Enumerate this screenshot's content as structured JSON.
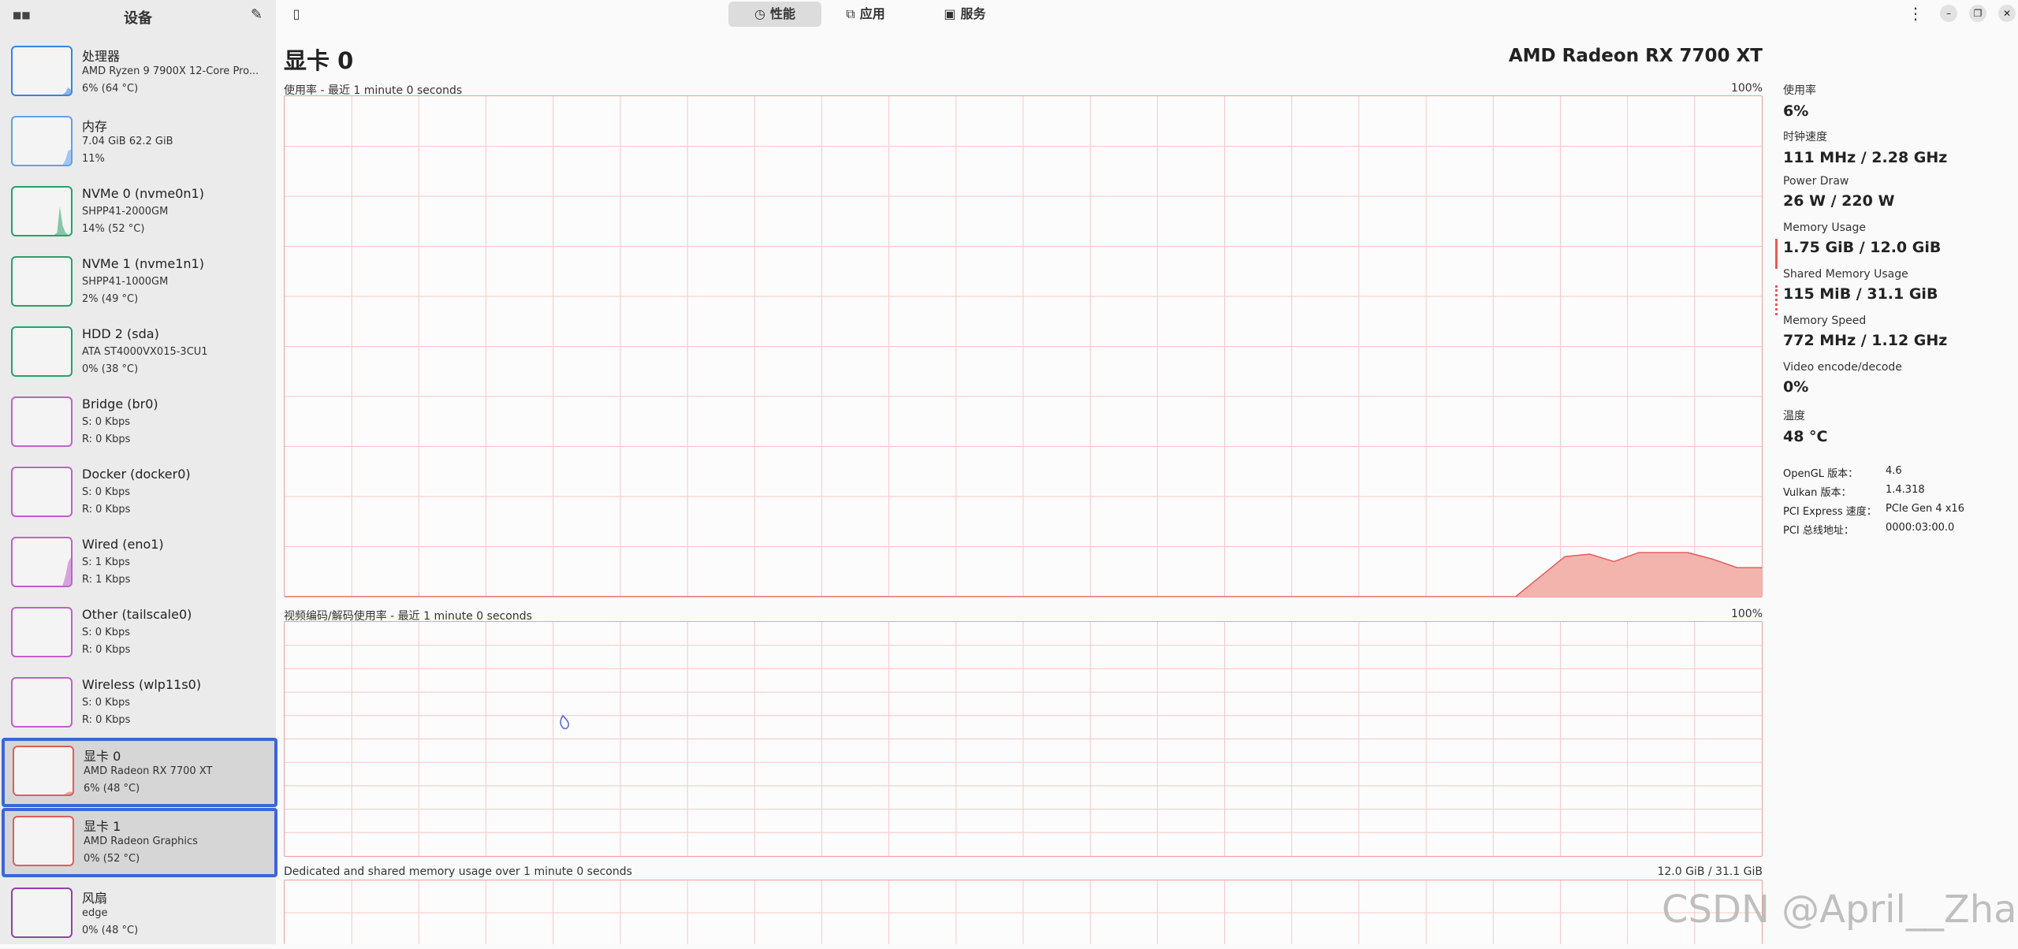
{
  "sidebar": {
    "mini_icon": "■■",
    "title": "设备",
    "edit_icon": "✎",
    "devices": [
      {
        "name": "处理器",
        "line1": "AMD Ryzen 9 7900X 12-Core Pro...",
        "line2": "6% (64 °C)",
        "color": "#3584e4",
        "selected": false,
        "spark": [
          0,
          0,
          0,
          0,
          0,
          0,
          0,
          0,
          0,
          0,
          0,
          0,
          0,
          0,
          0,
          0,
          0,
          0,
          0,
          0.05,
          0.15,
          0.1
        ]
      },
      {
        "name": "内存",
        "line1": "7.04 GiB 62.2 GiB",
        "line2": "11%",
        "color": "#62a0ea",
        "selected": false,
        "spark": [
          0,
          0,
          0,
          0,
          0,
          0,
          0,
          0,
          0,
          0,
          0,
          0,
          0,
          0,
          0,
          0,
          0,
          0,
          0,
          0.1,
          0.3,
          0.32
        ]
      },
      {
        "name": "NVMe 0 (nvme0n1)",
        "line1": "SHPP41-2000GM",
        "line2": "14% (52 °C)",
        "color": "#26a269",
        "selected": false,
        "spark": [
          0,
          0,
          0,
          0,
          0,
          0,
          0,
          0,
          0,
          0,
          0,
          0,
          0,
          0,
          0,
          0,
          0.05,
          0.6,
          0.2,
          0.05,
          0,
          0
        ]
      },
      {
        "name": "NVMe 1 (nvme1n1)",
        "line1": "SHPP41-1000GM",
        "line2": "2% (49 °C)",
        "color": "#26a269",
        "selected": false,
        "spark": [
          0,
          0,
          0,
          0,
          0,
          0,
          0,
          0,
          0,
          0,
          0,
          0,
          0,
          0,
          0,
          0,
          0,
          0,
          0,
          0,
          0,
          0
        ]
      },
      {
        "name": "HDD 2 (sda)",
        "line1": "ATA ST4000VX015-3CU1",
        "line2": "0% (38 °C)",
        "color": "#26a269",
        "selected": false,
        "spark": [
          0,
          0,
          0,
          0,
          0,
          0,
          0,
          0,
          0,
          0,
          0,
          0,
          0,
          0,
          0,
          0,
          0,
          0,
          0,
          0,
          0,
          0
        ]
      },
      {
        "name": "Bridge (br0)",
        "line1": "S: 0 Kbps",
        "line2": "R: 0 Kbps",
        "color": "#c061cb",
        "selected": false,
        "spark": [
          0,
          0,
          0,
          0,
          0,
          0,
          0,
          0,
          0,
          0,
          0,
          0,
          0,
          0,
          0,
          0,
          0,
          0,
          0,
          0,
          0,
          0
        ]
      },
      {
        "name": "Docker (docker0)",
        "line1": "S: 0 Kbps",
        "line2": "R: 0 Kbps",
        "color": "#c061cb",
        "selected": false,
        "spark": [
          0,
          0,
          0,
          0,
          0,
          0,
          0,
          0,
          0,
          0,
          0,
          0,
          0,
          0,
          0,
          0,
          0,
          0,
          0,
          0,
          0,
          0
        ]
      },
      {
        "name": "Wired (eno1)",
        "line1": "S: 1 Kbps",
        "line2": "R: 1 Kbps",
        "color": "#c061cb",
        "selected": false,
        "spark": [
          0,
          0,
          0,
          0,
          0,
          0,
          0,
          0,
          0,
          0,
          0,
          0,
          0,
          0,
          0,
          0,
          0,
          0,
          0,
          0.2,
          0.5,
          0.6
        ]
      },
      {
        "name": "Other (tailscale0)",
        "line1": "S: 0 Kbps",
        "line2": "R: 0 Kbps",
        "color": "#c061cb",
        "selected": false,
        "spark": [
          0,
          0,
          0,
          0,
          0,
          0,
          0,
          0,
          0,
          0,
          0,
          0,
          0,
          0,
          0,
          0,
          0,
          0,
          0,
          0,
          0,
          0
        ]
      },
      {
        "name": "Wireless (wlp11s0)",
        "line1": "S: 0 Kbps",
        "line2": "R: 0 Kbps",
        "color": "#c061cb",
        "selected": false,
        "spark": [
          0,
          0,
          0,
          0,
          0,
          0,
          0,
          0,
          0,
          0,
          0,
          0,
          0,
          0,
          0,
          0,
          0,
          0,
          0,
          0,
          0,
          0
        ]
      },
      {
        "name": "显卡 0",
        "line1": "AMD Radeon RX 7700 XT",
        "line2": "6% (48 °C)",
        "color": "#e25c5c",
        "selected": true,
        "spark": [
          0,
          0,
          0,
          0,
          0,
          0,
          0,
          0,
          0,
          0,
          0,
          0,
          0,
          0,
          0,
          0,
          0,
          0,
          0,
          0.04,
          0.06,
          0.05
        ]
      },
      {
        "name": "显卡 1",
        "line1": "AMD Radeon Graphics",
        "line2": "0% (52 °C)",
        "color": "#e25c5c",
        "selected": true,
        "spark": [
          0,
          0,
          0,
          0,
          0,
          0,
          0,
          0,
          0,
          0,
          0,
          0,
          0,
          0,
          0,
          0,
          0,
          0,
          0,
          0,
          0,
          0
        ]
      },
      {
        "name": "风扇",
        "line1": "edge",
        "line2": "0% (48 °C)",
        "color": "#9141ac",
        "selected": false,
        "spark": [
          0,
          0,
          0,
          0,
          0,
          0,
          0,
          0,
          0,
          0,
          0,
          0,
          0,
          0,
          0,
          0,
          0,
          0,
          0,
          0,
          0,
          0
        ]
      }
    ]
  },
  "topbar": {
    "sidebar_toggle_icon": "▯",
    "tabs": [
      {
        "label": "性能",
        "icon": "◷",
        "active": true
      },
      {
        "label": "应用",
        "icon": "⧉",
        "active": false
      },
      {
        "label": "服务",
        "icon": "▣",
        "active": false
      }
    ],
    "menu_icon": "⋮",
    "minimize_icon": "–",
    "maximize_icon": "❐",
    "close_icon": "✕"
  },
  "main": {
    "title": "显卡 0",
    "model": "AMD Radeon RX 7700 XT",
    "graphs": [
      {
        "label": "使用率 - 最近 1 minute 0 seconds",
        "max": "100%"
      },
      {
        "label": "视频编码/解码使用率 - 最近 1 minute 0 seconds",
        "max": "100%"
      },
      {
        "label": "Dedicated and shared memory usage over 1 minute 0 seconds",
        "max": "12.0 GiB / 31.1 GiB"
      }
    ],
    "grid_color": "#f6c8c8",
    "fill_color": "#f4b4ae",
    "line_color": "#e25c5c"
  },
  "chart_data": [
    {
      "type": "area",
      "title": "使用率 - 最近 1 minute 0 seconds",
      "ylim": [
        0,
        100
      ],
      "y_max_label": "100%",
      "grid": true,
      "x": [
        0,
        1,
        2,
        3,
        4,
        5,
        6,
        7,
        8,
        9,
        10,
        11,
        12,
        13,
        14,
        15,
        16,
        17,
        18,
        19,
        20,
        21,
        22,
        23,
        24,
        25,
        26,
        27,
        28,
        29,
        30,
        31,
        32,
        33,
        34,
        35,
        36,
        37,
        38,
        39,
        40,
        41,
        42,
        43,
        44,
        45,
        46,
        47,
        48,
        49,
        50,
        51,
        52,
        53,
        54,
        55,
        56,
        57,
        58,
        59,
        60
      ],
      "values": [
        0,
        0,
        0,
        0,
        0,
        0,
        0,
        0,
        0,
        0,
        0,
        0,
        0,
        0,
        0,
        0,
        0,
        0,
        0,
        0,
        0,
        0,
        0,
        0,
        0,
        0,
        0,
        0,
        0,
        0,
        0,
        0,
        0,
        0,
        0,
        0,
        0,
        0,
        0,
        0,
        0,
        0,
        0,
        0,
        0,
        0,
        0,
        0,
        0,
        0,
        0,
        4,
        8,
        8.5,
        7,
        8.8,
        8.8,
        8.8,
        7.5,
        5.8,
        5.8
      ]
    },
    {
      "type": "area",
      "title": "视频编码/解码使用率 - 最近 1 minute 0 seconds",
      "ylim": [
        0,
        100
      ],
      "y_max_label": "100%",
      "grid": true,
      "values": []
    },
    {
      "type": "area",
      "title": "Dedicated and shared memory usage over 1 minute 0 seconds",
      "y_max_label": "12.0 GiB / 31.1 GiB",
      "grid": true,
      "values": []
    }
  ],
  "stats": {
    "items": [
      {
        "label": "使用率",
        "value": "6%",
        "marker": "none"
      },
      {
        "label": "时钟速度",
        "value": "111 MHz / 2.28 GHz",
        "marker": "none"
      },
      {
        "label": "Power Draw",
        "value": "26 W / 220 W",
        "marker": "none"
      },
      {
        "label": "Memory Usage",
        "value": "1.75 GiB / 12.0 GiB",
        "marker": "solid"
      },
      {
        "label": "Shared Memory Usage",
        "value": "115 MiB / 31.1 GiB",
        "marker": "dotted"
      },
      {
        "label": "Memory Speed",
        "value": "772 MHz / 1.12 GHz",
        "marker": "none"
      },
      {
        "label": "Video encode/decode",
        "value": "0%",
        "marker": "none"
      },
      {
        "label": "温度",
        "value": "48 °C",
        "marker": "none"
      }
    ],
    "info": [
      {
        "key": "OpenGL 版本：",
        "value": "4.6"
      },
      {
        "key": "Vulkan 版本：",
        "value": "1.4.318"
      },
      {
        "key": "PCI Express 速度：",
        "value": "PCIe Gen 4 x16"
      },
      {
        "key": "PCI 总线地址：",
        "value": "0000:03:00.0"
      }
    ],
    "marker_color": "#e25c5c"
  },
  "watermark": "CSDN @April__Zhao"
}
